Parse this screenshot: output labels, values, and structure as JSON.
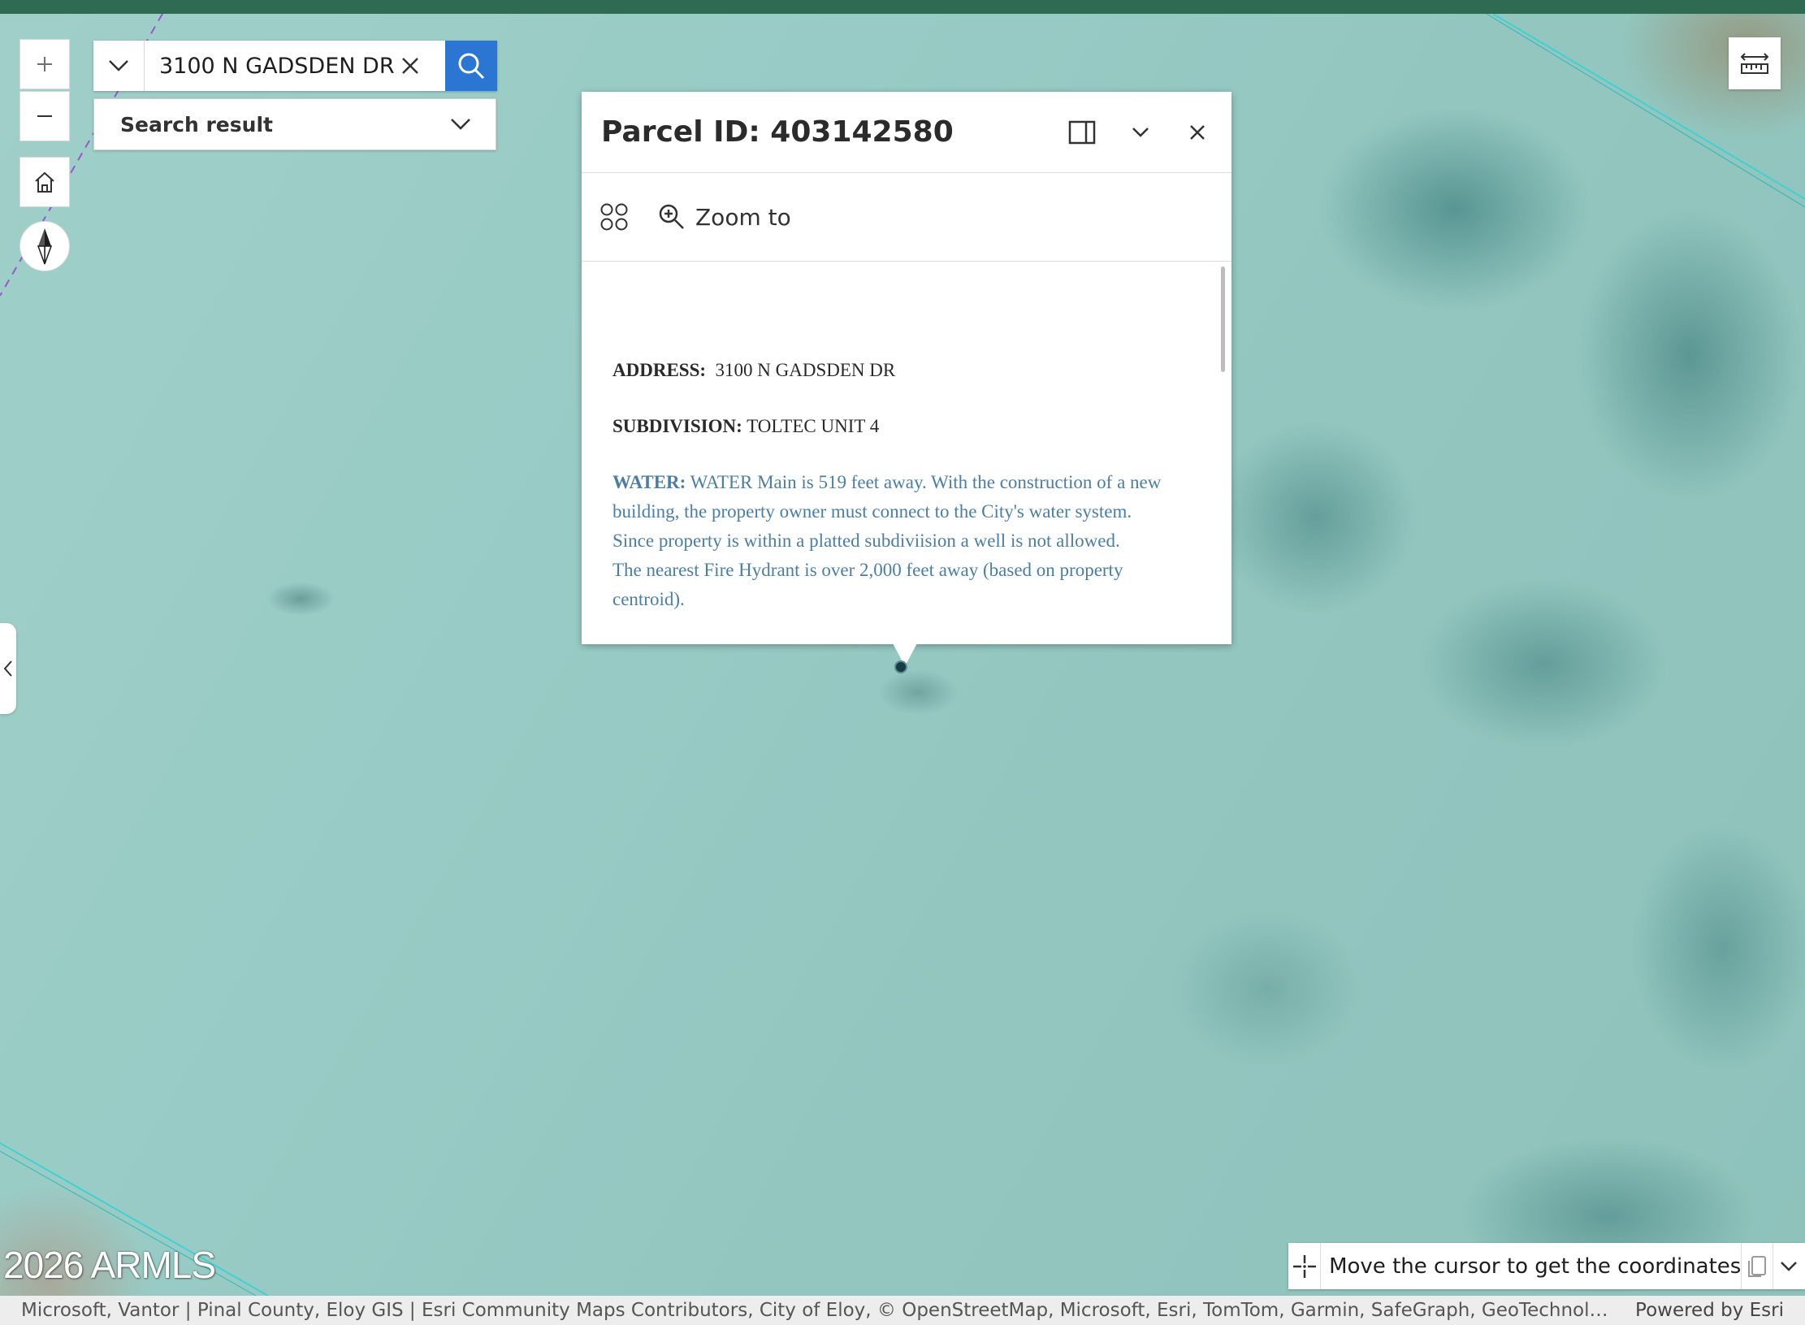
{
  "search": {
    "value": "3100 N GADSDEN DR",
    "result_label": "Search result"
  },
  "popup": {
    "title": "Parcel ID: 403142580",
    "zoom_label": "Zoom to",
    "address_label": "ADDRESS:",
    "address_value": "3100 N GADSDEN DR",
    "subdivision_label": "SUBDIVISION:",
    "subdivision_value": "TOLTEC UNIT 4",
    "water_label": "WATER:",
    "water_line1": "WATER Main is 519 feet away. With the construction of a new",
    "water_line2": "building, the property owner must connect to the City's water system.",
    "water_line3": "Since property is within a platted subdiviision a well is not allowed.",
    "water_line4": "The nearest Fire Hydrant is over 2,000 feet away (based on property",
    "water_line5": "centroid)."
  },
  "coordinates": {
    "prompt": "Move the cursor to get the coordinates"
  },
  "watermark": "2026 ARMLS",
  "attribution": {
    "text": "Microsoft, Vantor | Pinal County, Eloy GIS | Esri Community Maps Contributors, City of Eloy, © OpenStreetMap, Microsoft, Esri, TomTom, Garmin, SafeGraph, GeoTechnologies, Inc, M...",
    "powered_by": "Powered by Esri"
  },
  "colors": {
    "header_bar": "#2f6b52",
    "search_button": "#2a76d2",
    "water_text": "#4a7ea6",
    "map_base": "#98cbc5"
  },
  "icons": {
    "zoom_in": "plus-icon",
    "zoom_out": "minus-icon",
    "home": "home-icon",
    "compass": "compass-icon",
    "search_source": "chevron-down-icon",
    "clear": "close-icon",
    "search": "search-icon",
    "dock": "dock-panel-icon",
    "collapse": "chevron-down-icon",
    "close": "close-icon",
    "features": "four-circles-icon",
    "zoom_to": "zoom-in-magnifier-icon",
    "measure": "measure-icon",
    "crosshair": "crosshair-icon",
    "copy": "copy-icon",
    "expand": "chevron-down-icon",
    "side_collapse": "chevron-left-icon"
  }
}
